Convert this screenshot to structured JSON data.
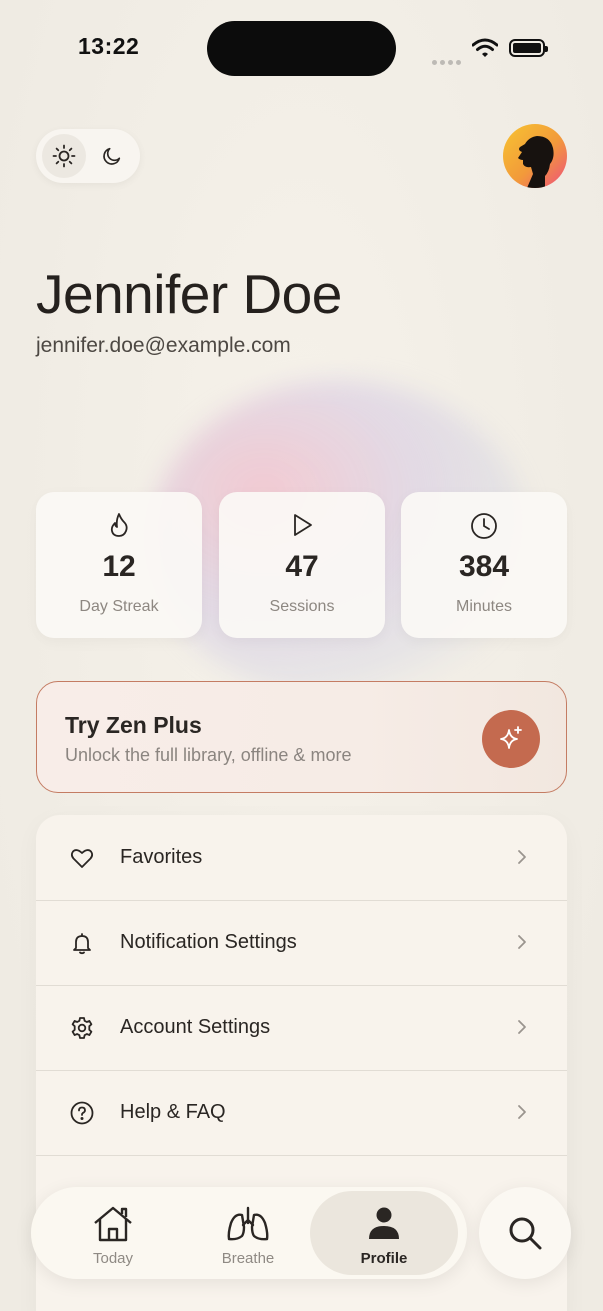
{
  "status_bar": {
    "time": "13:22"
  },
  "theme_toggle": {
    "light_icon": "sun-icon",
    "dark_icon": "moon-icon",
    "selected": "light"
  },
  "profile": {
    "name": "Jennifer Doe",
    "email": "jennifer.doe@example.com",
    "avatar": "avatar-silhouette"
  },
  "stats": [
    {
      "icon": "flame-icon",
      "value": "12",
      "label": "Day Streak"
    },
    {
      "icon": "play-icon",
      "value": "47",
      "label": "Sessions"
    },
    {
      "icon": "clock-icon",
      "value": "384",
      "label": "Minutes"
    }
  ],
  "promo": {
    "title": "Try Zen Plus",
    "subtitle": "Unlock the full library, offline & more",
    "icon": "sparkle-icon",
    "accent": "#c46a4f"
  },
  "menu": [
    {
      "icon": "heart-icon",
      "label": "Favorites"
    },
    {
      "icon": "bell-icon",
      "label": "Notification Settings"
    },
    {
      "icon": "gear-icon",
      "label": "Account Settings"
    },
    {
      "icon": "help-circle-icon",
      "label": "Help & FAQ"
    }
  ],
  "tabbar": {
    "tabs": [
      {
        "icon": "home-icon",
        "label": "Today"
      },
      {
        "icon": "lungs-icon",
        "label": "Breathe"
      },
      {
        "icon": "person-icon",
        "label": "Profile",
        "active": true
      }
    ],
    "search_icon": "search-icon"
  }
}
